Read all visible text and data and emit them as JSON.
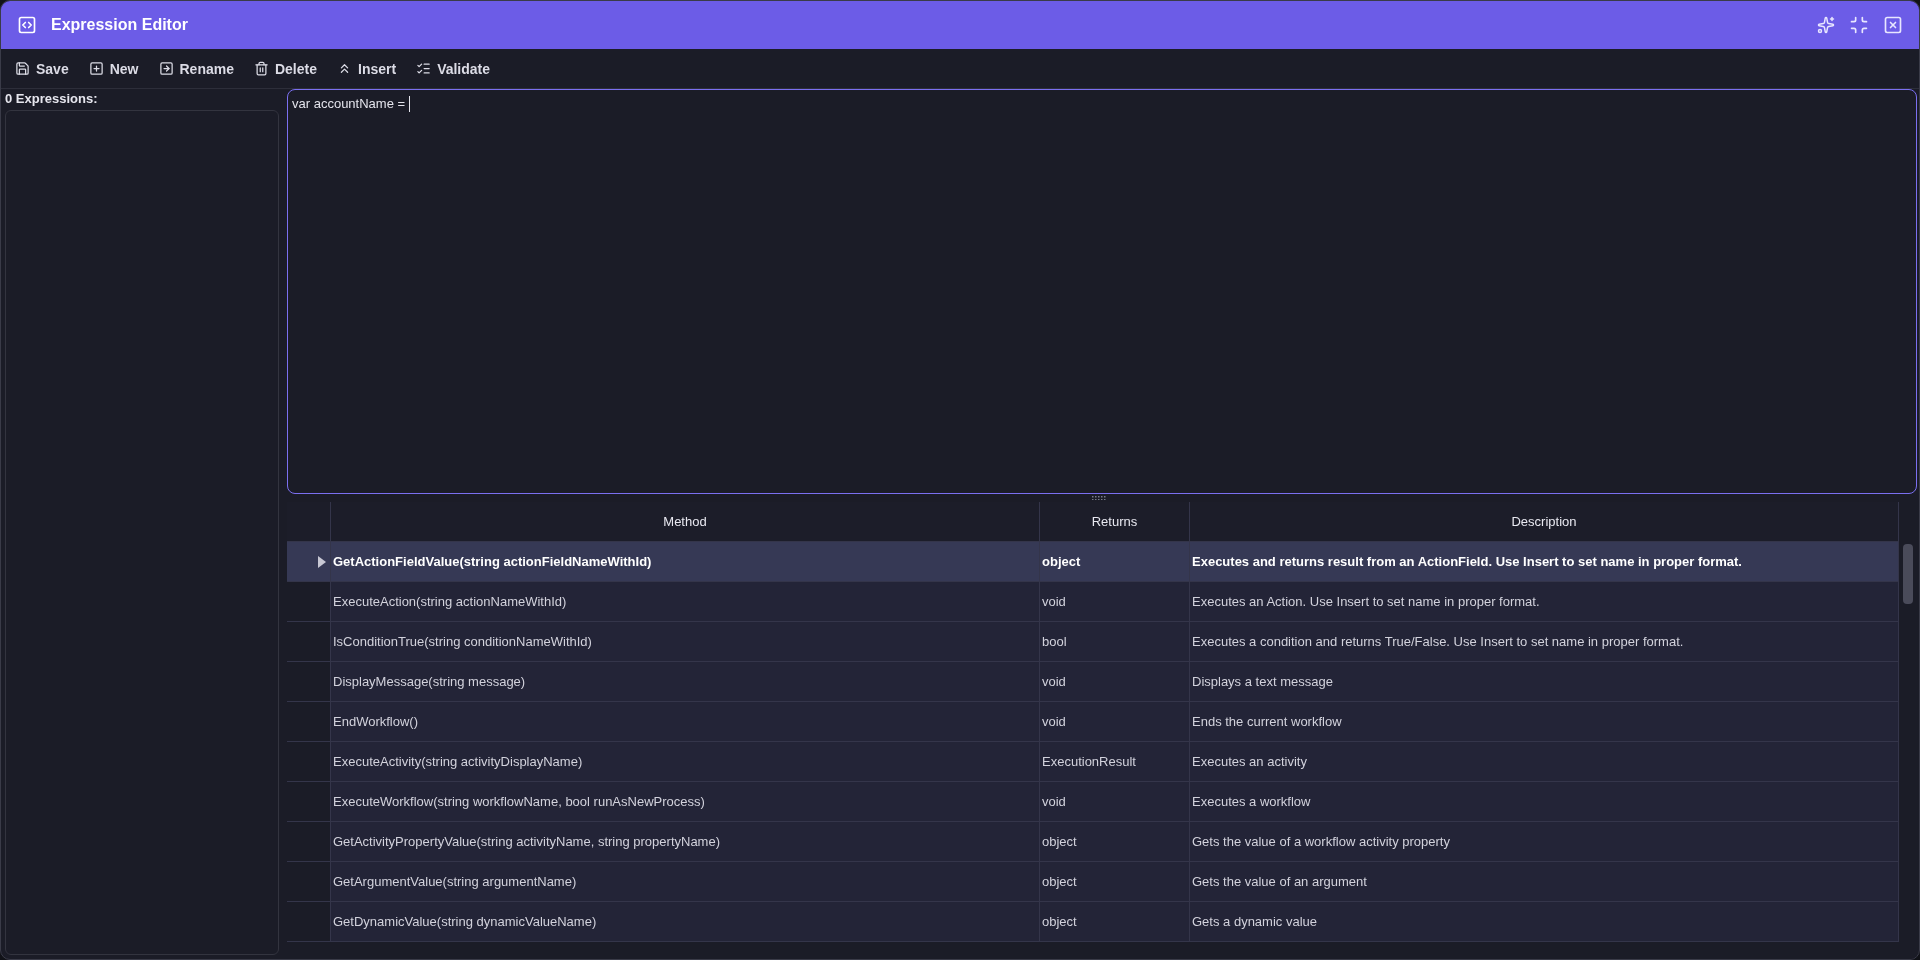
{
  "window": {
    "title": "Expression Editor"
  },
  "toolbar": [
    {
      "kind": "save",
      "label": "Save"
    },
    {
      "kind": "new",
      "label": "New"
    },
    {
      "kind": "rename",
      "label": "Rename"
    },
    {
      "kind": "delete",
      "label": "Delete"
    },
    {
      "kind": "insert",
      "label": "Insert"
    },
    {
      "kind": "validate",
      "label": "Validate"
    }
  ],
  "expressions": {
    "label": "0 Expressions:"
  },
  "editor": {
    "value": "var accountName = "
  },
  "table": {
    "columns": [
      "Method",
      "Returns",
      "Description"
    ],
    "rows": [
      {
        "method": "GetActionFieldValue(string actionFieldNameWithId)",
        "returns": "object",
        "description": "Executes and returns result from an ActionField. Use Insert to set name in proper format.",
        "selected": true
      },
      {
        "method": "ExecuteAction(string actionNameWithId)",
        "returns": "void",
        "description": "Executes an Action. Use Insert to set name in proper format.",
        "selected": false
      },
      {
        "method": "IsConditionTrue(string conditionNameWithId)",
        "returns": "bool",
        "description": "Executes a condition and returns True/False. Use Insert to set name in proper format.",
        "selected": false
      },
      {
        "method": "DisplayMessage(string message)",
        "returns": "void",
        "description": "Displays a text message",
        "selected": false
      },
      {
        "method": "EndWorkflow()",
        "returns": "void",
        "description": "Ends the current workflow",
        "selected": false
      },
      {
        "method": "ExecuteActivity(string activityDisplayName)",
        "returns": "ExecutionResult",
        "description": "Executes an activity",
        "selected": false
      },
      {
        "method": "ExecuteWorkflow(string workflowName, bool runAsNewProcess)",
        "returns": "void",
        "description": "Executes a workflow",
        "selected": false
      },
      {
        "method": "GetActivityPropertyValue(string activityName, string propertyName)",
        "returns": "object",
        "description": "Gets the value of a workflow activity property",
        "selected": false
      },
      {
        "method": "GetArgumentValue(string argumentName)",
        "returns": "object",
        "description": "Gets the value of an argument",
        "selected": false
      },
      {
        "method": "GetDynamicValue(string dynamicValueName)",
        "returns": "object",
        "description": "Gets a dynamic value",
        "selected": false
      }
    ]
  }
}
